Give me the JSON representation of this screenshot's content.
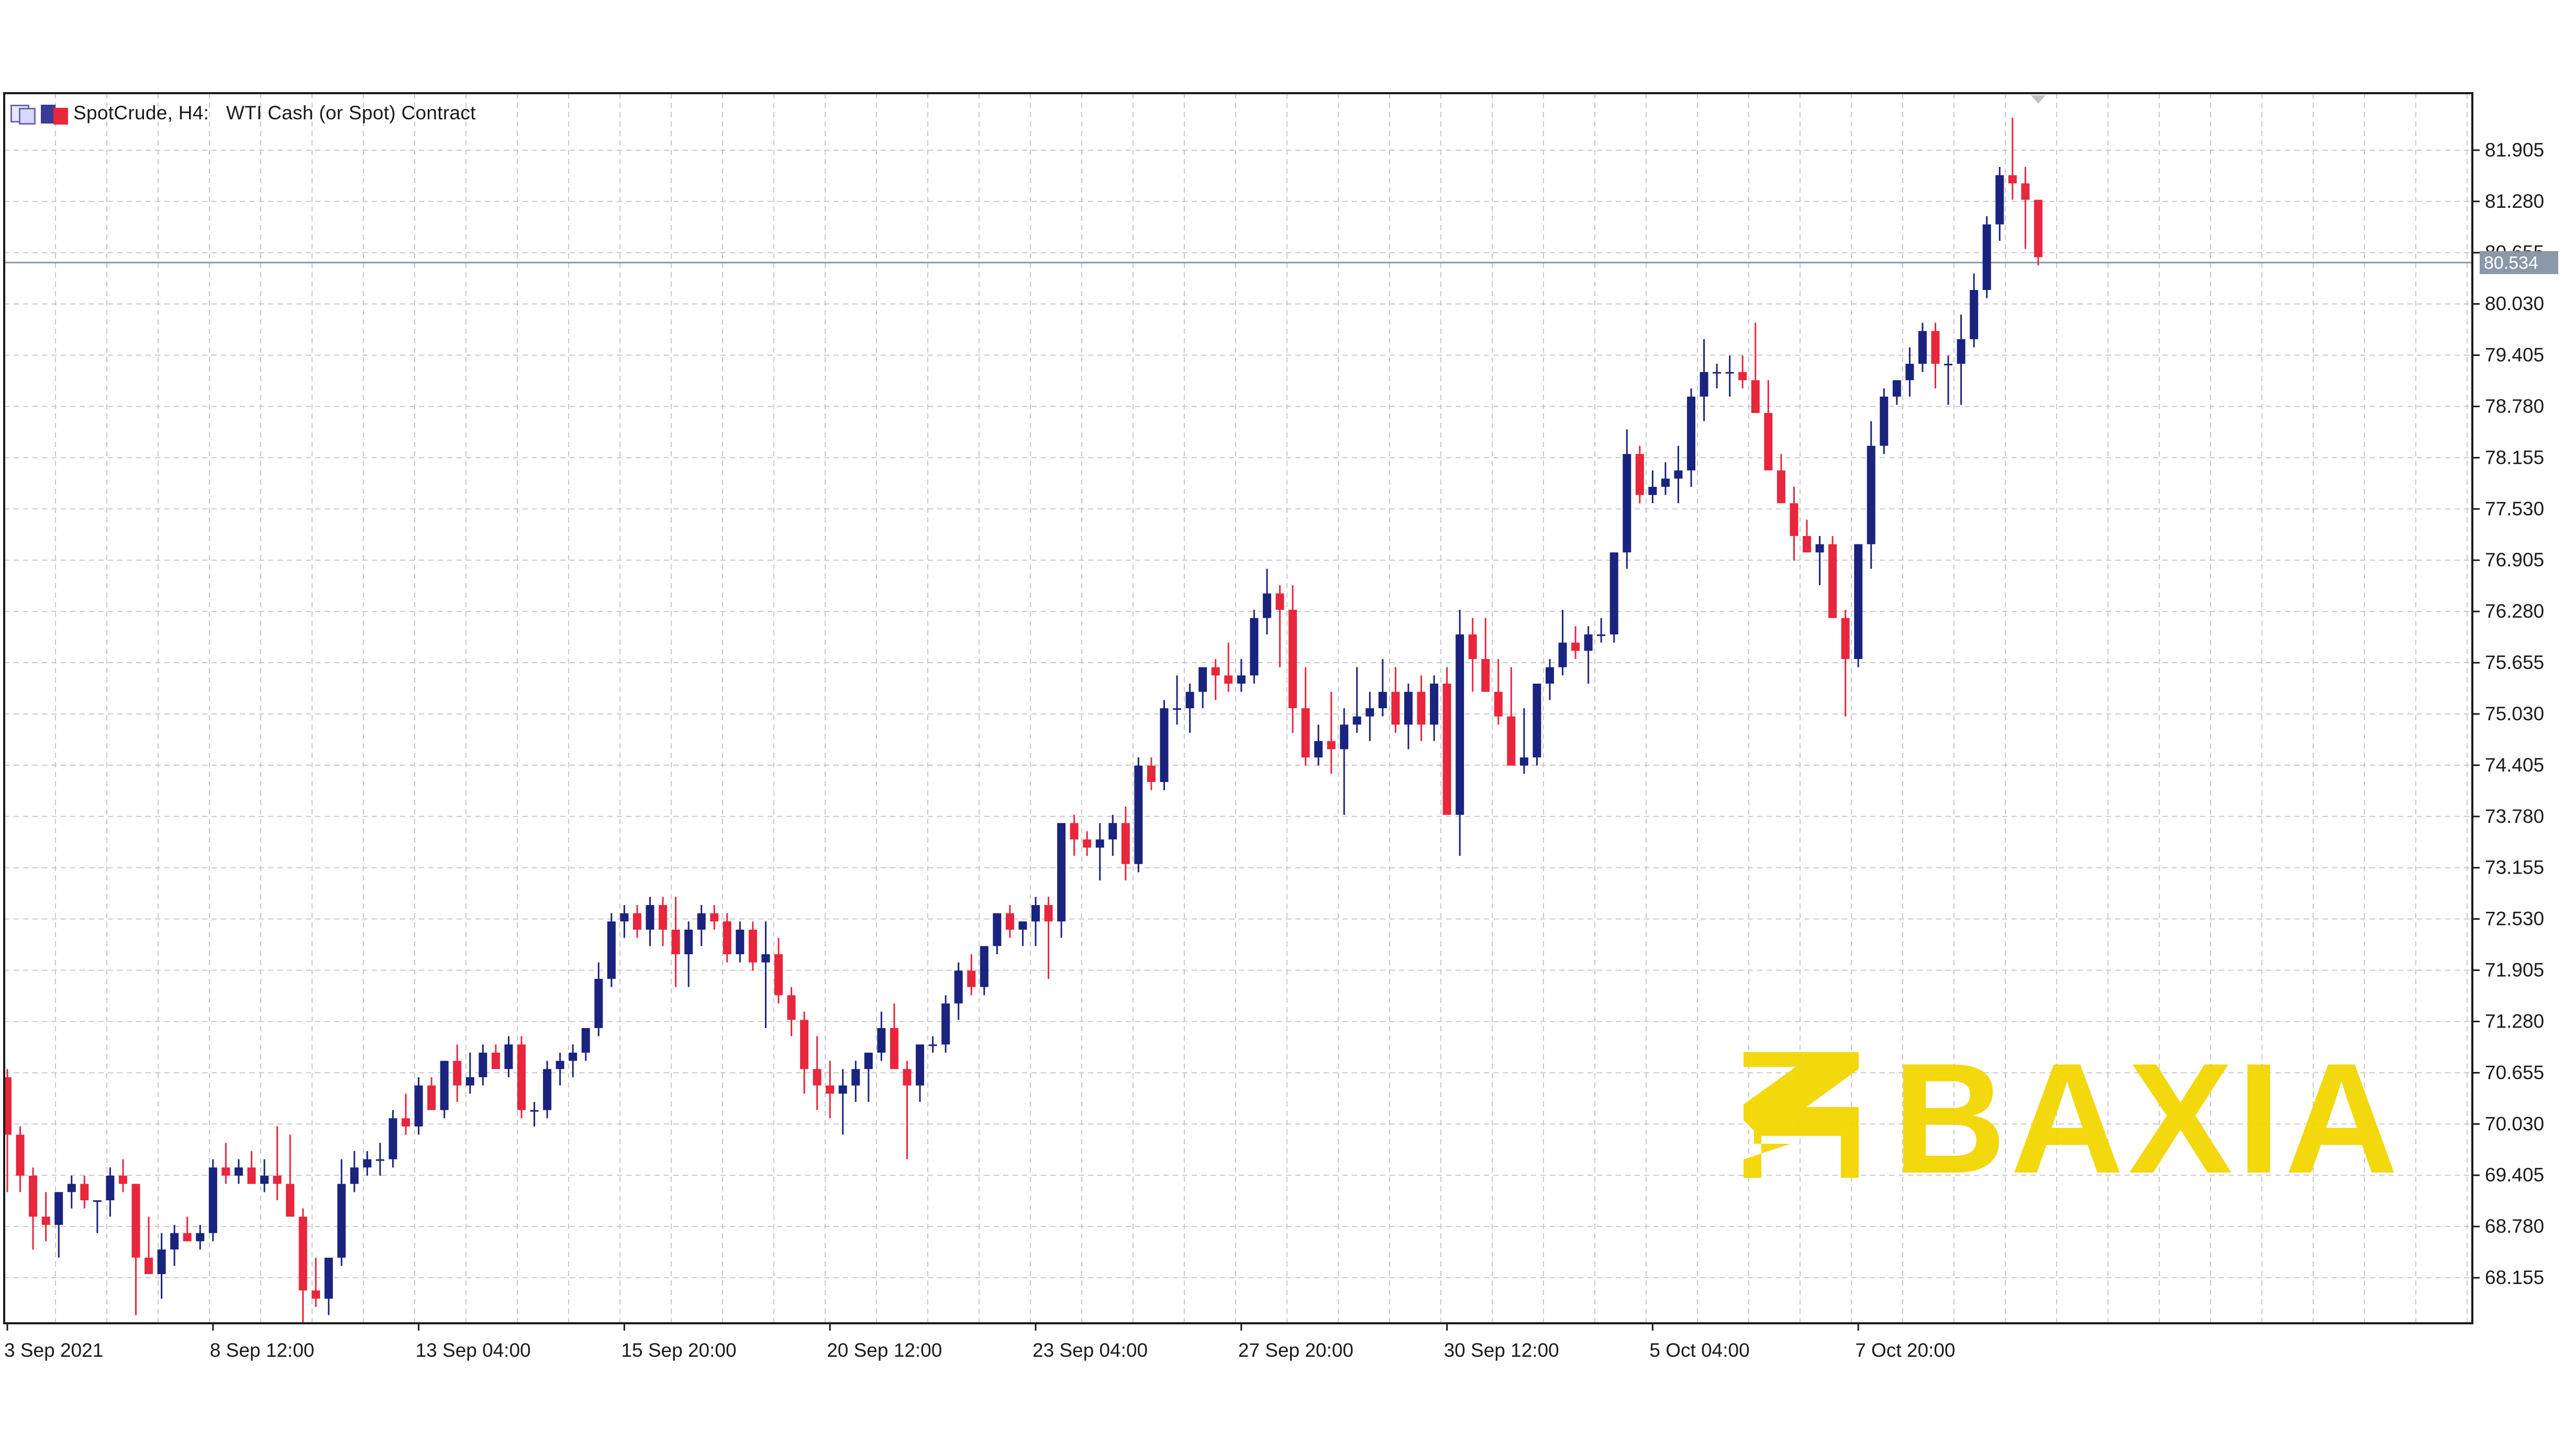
{
  "chart_header": {
    "symbol_timeframe": "SpotCrude, H4:",
    "description": "WTI Cash (or Spot) Contract"
  },
  "watermark": {
    "text": "BAXIA",
    "color": "#f2d600"
  },
  "colors": {
    "bull": "#1a237e",
    "bear": "#e8263c",
    "grid": "#c8c8c8",
    "price_line": "#8a98a8",
    "price_tag_bg": "#8a98a8"
  },
  "chart_data": {
    "type": "candlestick",
    "title": "SpotCrude, H4: WTI Cash (or Spot) Contract",
    "current_price": 80.534,
    "current_price_label": "80.534",
    "ylim": [
      67.6,
      82.6
    ],
    "y_ticks": [
      81.905,
      81.28,
      80.655,
      80.03,
      79.405,
      78.78,
      78.155,
      77.53,
      76.905,
      76.28,
      75.655,
      75.03,
      74.405,
      73.78,
      73.155,
      72.53,
      71.905,
      71.28,
      70.655,
      70.03,
      69.405,
      68.78,
      68.155
    ],
    "y_tick_labels": [
      "81.905",
      "81.280",
      "80.655",
      "80.030",
      "79.405",
      "78.780",
      "78.155",
      "77.530",
      "76.905",
      "76.280",
      "75.655",
      "75.030",
      "74.405",
      "73.780",
      "73.155",
      "72.530",
      "71.905",
      "71.280",
      "70.655",
      "70.030",
      "69.405",
      "68.780",
      "68.155"
    ],
    "x_tick_labels": [
      {
        "bar": 0,
        "label": "3 Sep 2021"
      },
      {
        "bar": 16,
        "label": "8 Sep 12:00"
      },
      {
        "bar": 32,
        "label": "13 Sep 04:00"
      },
      {
        "bar": 48,
        "label": "15 Sep 20:00"
      },
      {
        "bar": 64,
        "label": "20 Sep 12:00"
      },
      {
        "bar": 80,
        "label": "23 Sep 04:00"
      },
      {
        "bar": 96,
        "label": "27 Sep 20:00"
      },
      {
        "bar": 112,
        "label": "30 Sep 12:00"
      },
      {
        "bar": 128,
        "label": "5 Oct 04:00"
      },
      {
        "bar": 144,
        "label": "7 Oct 20:00"
      }
    ],
    "candles": [
      [
        70.6,
        70.7,
        69.2,
        69.9
      ],
      [
        69.9,
        70.0,
        69.2,
        69.4
      ],
      [
        69.4,
        69.5,
        68.5,
        68.9
      ],
      [
        68.9,
        69.2,
        68.6,
        68.8
      ],
      [
        68.8,
        69.0,
        68.4,
        69.2
      ],
      [
        69.2,
        69.4,
        69.0,
        69.3
      ],
      [
        69.3,
        69.4,
        69.0,
        69.1
      ],
      [
        69.1,
        69.1,
        68.7,
        69.1
      ],
      [
        69.1,
        69.5,
        68.9,
        69.4
      ],
      [
        69.4,
        69.6,
        69.2,
        69.3
      ],
      [
        69.3,
        69.3,
        67.7,
        68.4
      ],
      [
        68.4,
        68.9,
        68.2,
        68.2
      ],
      [
        68.2,
        68.7,
        67.9,
        68.5
      ],
      [
        68.5,
        68.8,
        68.3,
        68.7
      ],
      [
        68.7,
        68.9,
        68.6,
        68.6
      ],
      [
        68.6,
        68.8,
        68.5,
        68.7
      ],
      [
        68.7,
        69.6,
        68.6,
        69.5
      ],
      [
        69.5,
        69.8,
        69.3,
        69.4
      ],
      [
        69.4,
        69.6,
        69.3,
        69.5
      ],
      [
        69.5,
        69.7,
        69.3,
        69.3
      ],
      [
        69.3,
        69.6,
        69.2,
        69.4
      ],
      [
        69.4,
        70.0,
        69.1,
        69.3
      ],
      [
        69.3,
        69.9,
        68.9,
        68.9
      ],
      [
        68.9,
        69.0,
        67.6,
        68.0
      ],
      [
        68.0,
        68.4,
        67.8,
        67.9
      ],
      [
        67.9,
        68.3,
        67.7,
        68.4
      ],
      [
        68.4,
        69.6,
        68.3,
        69.3
      ],
      [
        69.3,
        69.7,
        69.2,
        69.5
      ],
      [
        69.5,
        69.7,
        69.4,
        69.6
      ],
      [
        69.6,
        69.8,
        69.4,
        69.6
      ],
      [
        69.6,
        70.2,
        69.5,
        70.1
      ],
      [
        70.1,
        70.4,
        69.9,
        70.0
      ],
      [
        70.0,
        70.6,
        69.9,
        70.5
      ],
      [
        70.5,
        70.6,
        70.2,
        70.2
      ],
      [
        70.2,
        70.8,
        70.1,
        70.8
      ],
      [
        70.8,
        71.0,
        70.3,
        70.5
      ],
      [
        70.5,
        70.9,
        70.4,
        70.6
      ],
      [
        70.6,
        71.0,
        70.5,
        70.9
      ],
      [
        70.9,
        71.0,
        70.7,
        70.7
      ],
      [
        70.7,
        71.1,
        70.6,
        71.0
      ],
      [
        71.0,
        71.1,
        70.1,
        70.2
      ],
      [
        70.2,
        70.3,
        70.0,
        70.2
      ],
      [
        70.2,
        70.8,
        70.1,
        70.7
      ],
      [
        70.7,
        70.9,
        70.5,
        70.8
      ],
      [
        70.8,
        71.0,
        70.6,
        70.9
      ],
      [
        70.9,
        71.1,
        70.8,
        71.2
      ],
      [
        71.2,
        72.0,
        71.1,
        71.8
      ],
      [
        71.8,
        72.6,
        71.7,
        72.5
      ],
      [
        72.5,
        72.7,
        72.3,
        72.6
      ],
      [
        72.6,
        72.7,
        72.3,
        72.4
      ],
      [
        72.4,
        72.8,
        72.2,
        72.7
      ],
      [
        72.7,
        72.8,
        72.2,
        72.4
      ],
      [
        72.4,
        72.8,
        71.7,
        72.1
      ],
      [
        72.1,
        72.5,
        71.7,
        72.4
      ],
      [
        72.4,
        72.7,
        72.2,
        72.6
      ],
      [
        72.6,
        72.7,
        72.4,
        72.5
      ],
      [
        72.5,
        72.6,
        72.0,
        72.1
      ],
      [
        72.1,
        72.5,
        72.0,
        72.4
      ],
      [
        72.4,
        72.5,
        71.9,
        72.0
      ],
      [
        72.0,
        72.5,
        71.2,
        72.1
      ],
      [
        72.1,
        72.3,
        71.5,
        71.6
      ],
      [
        71.6,
        71.7,
        71.1,
        71.3
      ],
      [
        71.3,
        71.4,
        70.4,
        70.7
      ],
      [
        70.7,
        71.1,
        70.2,
        70.5
      ],
      [
        70.5,
        70.8,
        70.1,
        70.4
      ],
      [
        70.4,
        70.7,
        69.9,
        70.5
      ],
      [
        70.5,
        70.8,
        70.3,
        70.7
      ],
      [
        70.7,
        70.8,
        70.3,
        70.9
      ],
      [
        70.9,
        71.4,
        70.8,
        71.2
      ],
      [
        71.2,
        71.5,
        70.8,
        70.7
      ],
      [
        70.7,
        70.8,
        69.6,
        70.5
      ],
      [
        70.5,
        71.0,
        70.3,
        71.0
      ],
      [
        71.0,
        71.1,
        70.9,
        71.0
      ],
      [
        71.0,
        71.6,
        70.9,
        71.5
      ],
      [
        71.5,
        72.0,
        71.3,
        71.9
      ],
      [
        71.9,
        72.1,
        71.6,
        71.7
      ],
      [
        71.7,
        72.1,
        71.6,
        72.2
      ],
      [
        72.2,
        72.6,
        72.1,
        72.6
      ],
      [
        72.6,
        72.7,
        72.3,
        72.4
      ],
      [
        72.4,
        72.5,
        72.2,
        72.5
      ],
      [
        72.5,
        72.8,
        72.2,
        72.7
      ],
      [
        72.7,
        72.8,
        71.8,
        72.5
      ],
      [
        72.5,
        72.7,
        72.3,
        73.7
      ],
      [
        73.7,
        73.8,
        73.3,
        73.5
      ],
      [
        73.5,
        73.6,
        73.3,
        73.4
      ],
      [
        73.4,
        73.7,
        73.0,
        73.5
      ],
      [
        73.5,
        73.8,
        73.3,
        73.7
      ],
      [
        73.7,
        73.9,
        73.0,
        73.2
      ],
      [
        73.2,
        74.5,
        73.1,
        74.4
      ],
      [
        74.4,
        74.5,
        74.1,
        74.2
      ],
      [
        74.2,
        75.2,
        74.1,
        75.1
      ],
      [
        75.1,
        75.5,
        74.9,
        75.1
      ],
      [
        75.1,
        75.4,
        74.8,
        75.3
      ],
      [
        75.3,
        75.6,
        75.1,
        75.6
      ],
      [
        75.6,
        75.7,
        75.2,
        75.5
      ],
      [
        75.5,
        75.9,
        75.3,
        75.4
      ],
      [
        75.4,
        75.7,
        75.3,
        75.5
      ],
      [
        75.5,
        76.3,
        75.4,
        76.2
      ],
      [
        76.2,
        76.8,
        76.0,
        76.5
      ],
      [
        76.5,
        76.6,
        75.6,
        76.3
      ],
      [
        76.3,
        76.6,
        74.8,
        75.1
      ],
      [
        75.1,
        75.6,
        74.4,
        74.5
      ],
      [
        74.5,
        74.9,
        74.4,
        74.7
      ],
      [
        74.7,
        75.3,
        74.3,
        74.6
      ],
      [
        74.6,
        75.1,
        73.8,
        74.9
      ],
      [
        74.9,
        75.6,
        74.8,
        75.0
      ],
      [
        75.0,
        75.3,
        74.7,
        75.1
      ],
      [
        75.1,
        75.7,
        75.0,
        75.3
      ],
      [
        75.3,
        75.6,
        74.8,
        74.9
      ],
      [
        74.9,
        75.4,
        74.6,
        75.3
      ],
      [
        75.3,
        75.5,
        74.7,
        74.9
      ],
      [
        74.9,
        75.5,
        74.7,
        75.4
      ],
      [
        75.4,
        75.6,
        73.8,
        73.8
      ],
      [
        73.8,
        76.3,
        73.3,
        76.0
      ],
      [
        76.0,
        76.2,
        75.3,
        75.7
      ],
      [
        75.7,
        76.2,
        75.3,
        75.3
      ],
      [
        75.3,
        75.7,
        74.9,
        75.0
      ],
      [
        75.0,
        75.6,
        74.8,
        74.4
      ],
      [
        74.4,
        75.1,
        74.3,
        74.5
      ],
      [
        74.5,
        75.0,
        74.4,
        75.4
      ],
      [
        75.4,
        75.7,
        75.2,
        75.6
      ],
      [
        75.6,
        76.3,
        75.5,
        75.9
      ],
      [
        75.9,
        76.1,
        75.7,
        75.8
      ],
      [
        75.8,
        76.1,
        75.4,
        76.0
      ],
      [
        76.0,
        76.2,
        75.9,
        76.0
      ],
      [
        76.0,
        77.0,
        75.9,
        77.0
      ],
      [
        77.0,
        78.5,
        76.8,
        78.2
      ],
      [
        78.2,
        78.3,
        77.6,
        77.7
      ],
      [
        77.7,
        78.0,
        77.6,
        77.8
      ],
      [
        77.8,
        78.1,
        77.7,
        77.9
      ],
      [
        77.9,
        78.3,
        77.6,
        78.0
      ],
      [
        78.0,
        79.0,
        77.8,
        78.9
      ],
      [
        78.9,
        79.6,
        78.6,
        79.2
      ],
      [
        79.2,
        79.3,
        79.0,
        79.2
      ],
      [
        79.2,
        79.4,
        78.9,
        79.2
      ],
      [
        79.2,
        79.4,
        79.0,
        79.1
      ],
      [
        79.1,
        79.8,
        78.7,
        78.7
      ],
      [
        78.7,
        79.1,
        78.5,
        78.0
      ],
      [
        78.0,
        78.2,
        77.6,
        77.6
      ],
      [
        77.6,
        77.8,
        76.9,
        77.2
      ],
      [
        77.2,
        77.4,
        77.1,
        77.0
      ],
      [
        77.0,
        77.2,
        76.6,
        77.1
      ],
      [
        77.1,
        77.2,
        76.2,
        76.2
      ],
      [
        76.2,
        76.3,
        75.0,
        75.7
      ],
      [
        75.7,
        77.1,
        75.6,
        77.1
      ],
      [
        77.1,
        78.6,
        76.8,
        78.3
      ],
      [
        78.3,
        79.0,
        78.2,
        78.9
      ],
      [
        78.9,
        79.1,
        78.8,
        79.1
      ],
      [
        79.1,
        79.5,
        78.9,
        79.3
      ],
      [
        79.3,
        79.8,
        79.2,
        79.7
      ],
      [
        79.7,
        79.8,
        79.0,
        79.3
      ],
      [
        79.3,
        79.4,
        78.8,
        79.3
      ],
      [
        79.3,
        79.9,
        78.8,
        79.6
      ],
      [
        79.6,
        80.4,
        79.5,
        80.2
      ],
      [
        80.2,
        81.1,
        80.1,
        81.0
      ],
      [
        81.0,
        81.7,
        80.8,
        81.6
      ],
      [
        81.6,
        82.3,
        81.3,
        81.5
      ],
      [
        81.5,
        81.7,
        80.7,
        81.3
      ],
      [
        81.3,
        81.3,
        80.5,
        80.6
      ]
    ]
  }
}
